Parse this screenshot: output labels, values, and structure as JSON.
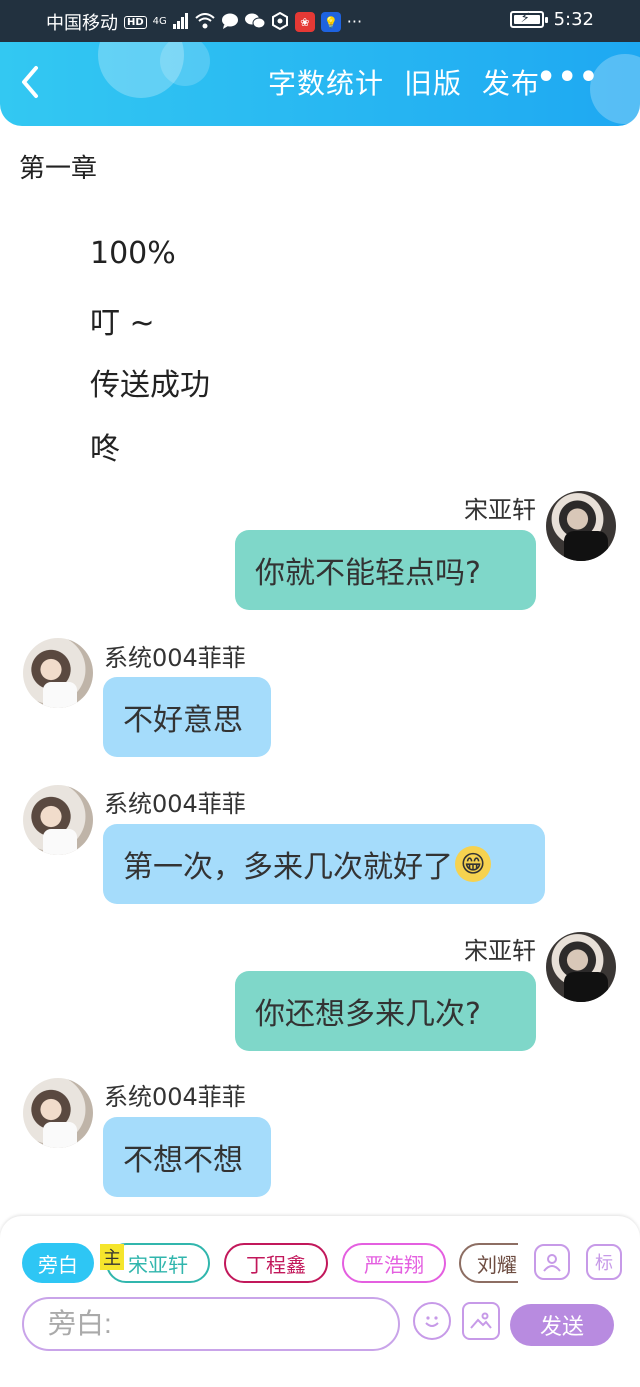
{
  "status_bar": {
    "carrier": "中国移动",
    "hd": "HD",
    "network": "4G",
    "time": "5:32"
  },
  "header": {
    "actions": [
      "字数统计",
      "旧版",
      "发布"
    ],
    "more": "•••"
  },
  "story": {
    "chapter_title": "第一章",
    "narration": [
      "100%",
      "叮 ~",
      "传送成功",
      "咚"
    ],
    "messages": [
      {
        "side": "right",
        "speaker": "宋亚轩",
        "text": "你就不能轻点吗?"
      },
      {
        "side": "left",
        "speaker": "系统004菲菲",
        "text": "不好意思"
      },
      {
        "side": "left",
        "speaker": "系统004菲菲",
        "text": "第一次，多来几次就好了",
        "emoji": "grinning-face"
      },
      {
        "side": "right",
        "speaker": "宋亚轩",
        "text": "你还想多来几次?"
      },
      {
        "side": "left",
        "speaker": "系统004菲菲",
        "text": "不想不想"
      }
    ]
  },
  "composer": {
    "roles": [
      {
        "label": "旁白",
        "active": true,
        "color": "#2ec6f4"
      },
      {
        "label": "宋亚轩",
        "active": false,
        "color": "#31b6ad"
      },
      {
        "label": "丁程鑫",
        "active": false,
        "color": "#c2185b"
      },
      {
        "label": "严浩翔",
        "active": false,
        "color": "#e45fe0"
      },
      {
        "label": "刘耀",
        "active": false,
        "color": "#8d6e63"
      }
    ],
    "main_tag": "主",
    "tag_button": "标",
    "input_placeholder": "旁白:",
    "send_label": "发送"
  },
  "colors": {
    "header_start": "#33c8f2",
    "header_end": "#1ea8f2",
    "bubble_self": "#7fd7c9",
    "bubble_other": "#a5dcfb",
    "accent_purple": "#b88be0"
  }
}
